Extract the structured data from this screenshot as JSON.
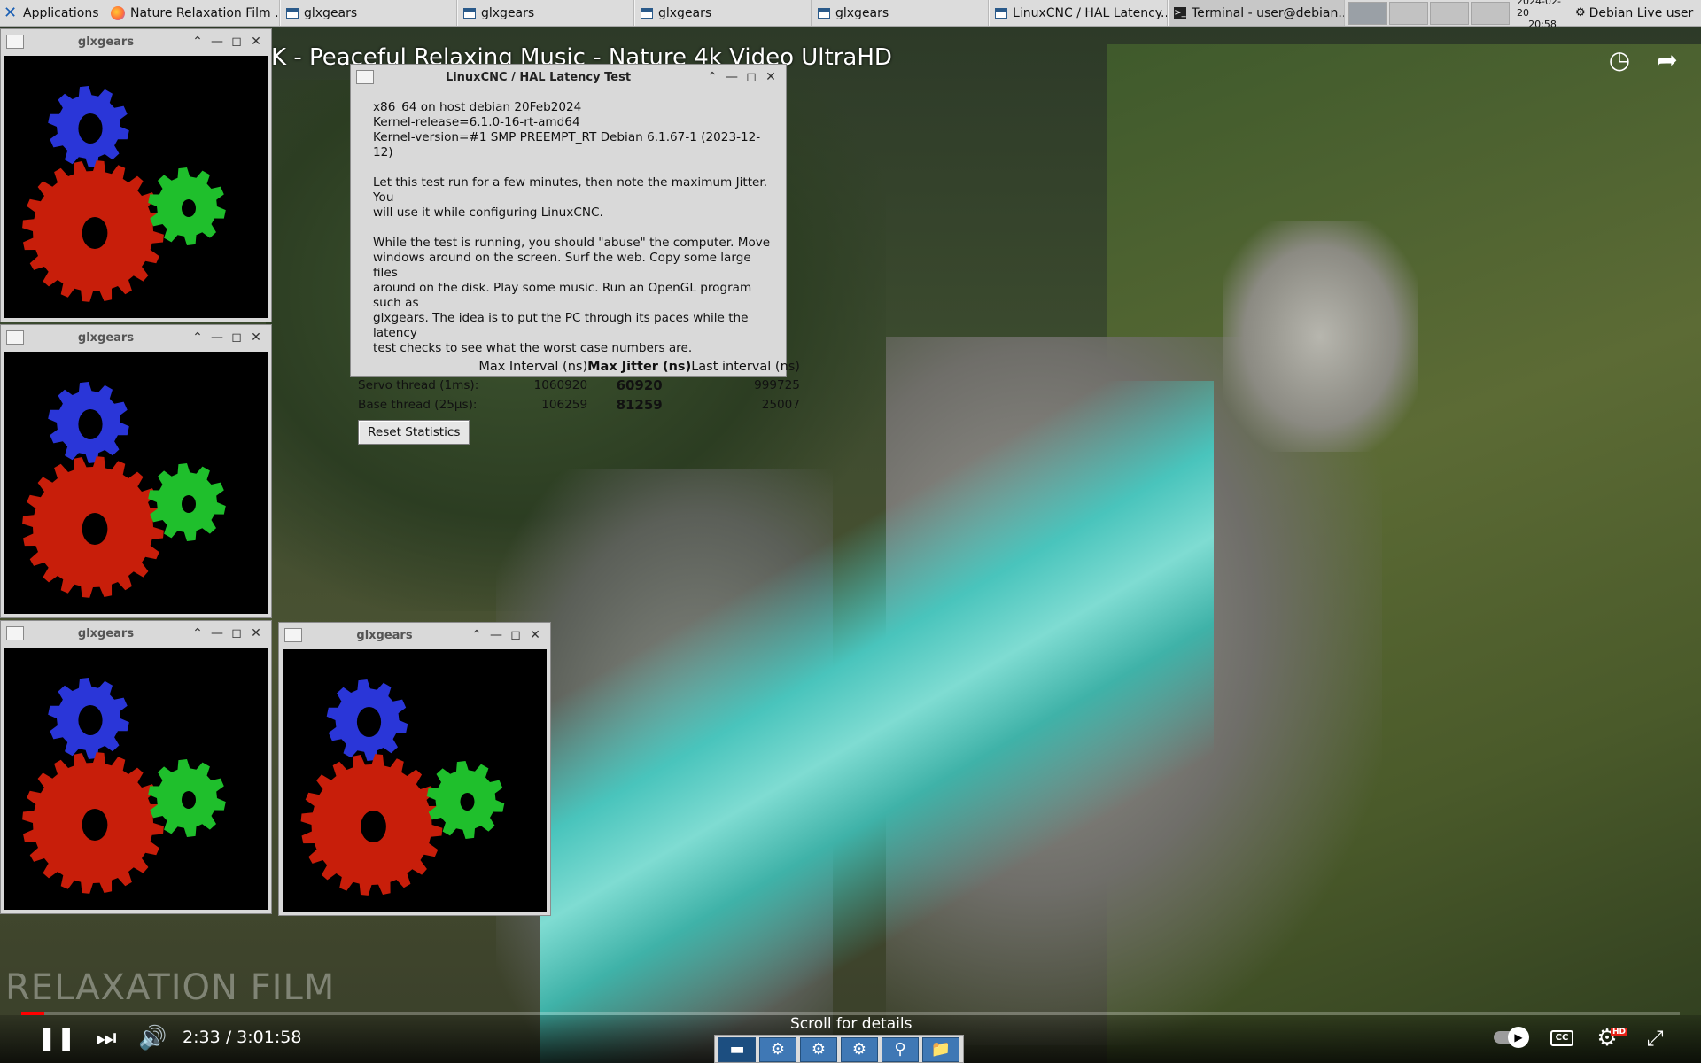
{
  "taskbar": {
    "applications_label": "Applications",
    "tasks": [
      {
        "label": "Nature Relaxation Film ...",
        "icon": "firefox-icon"
      },
      {
        "label": "glxgears",
        "icon": "window-icon"
      },
      {
        "label": "glxgears",
        "icon": "window-icon"
      },
      {
        "label": "glxgears",
        "icon": "window-icon"
      },
      {
        "label": "glxgears",
        "icon": "window-icon"
      },
      {
        "label": "LinuxCNC / HAL Latency...",
        "icon": "window-icon"
      },
      {
        "label": "Terminal - user@debian...",
        "icon": "terminal-icon"
      }
    ],
    "clock_date": "2024-02-20",
    "clock_time": "20:58",
    "user": "Debian Live user"
  },
  "video": {
    "title": "K - Peaceful Relaxing Music - Nature 4k Video UltraHD",
    "watermark": "RELAXATION FILM",
    "time_current": "2:33",
    "time_total": "3:01:58",
    "time_separator": " / ",
    "progress_fraction": 0.014,
    "scroll_hint": "Scroll for details",
    "hd_label": "HD",
    "cc_label": "CC"
  },
  "glxgears_windows": [
    {
      "title": "glxgears"
    },
    {
      "title": "glxgears"
    },
    {
      "title": "glxgears"
    },
    {
      "title": "glxgears"
    }
  ],
  "latency": {
    "title": "LinuxCNC / HAL Latency Test",
    "info": "x86_64 on host debian 20Feb2024\nKernel-release=6.1.0-16-rt-amd64\nKernel-version=#1 SMP PREEMPT_RT Debian 6.1.67-1 (2023-12-12)",
    "instructions": "Let this test run for a few minutes, then note the maximum Jitter. You\nwill use it while configuring LinuxCNC.",
    "abuse": "While the test is running, you should \"abuse\" the computer. Move\nwindows around on the screen. Surf the web. Copy some large files\naround on the disk. Play some music. Run an OpenGL program such as\nglxgears. The idea is to put the PC through its paces while the latency\ntest checks to see what the worst case numbers are.",
    "headers": [
      "Max Interval (ns)",
      "Max Jitter (ns)",
      "Last interval (ns)"
    ],
    "rows": [
      {
        "label": "Servo thread (1ms):",
        "max_interval": "1060920",
        "max_jitter": "60920",
        "last_interval": "999725"
      },
      {
        "label": "Base thread (25µs):",
        "max_interval": "106259",
        "max_jitter": "81259",
        "last_interval": "25007"
      }
    ],
    "reset_label": "Reset Statistics"
  },
  "colors": {
    "gear_red": "#c81e0a",
    "gear_green": "#1fbf2c",
    "gear_blue": "#2a36d8",
    "progress_red": "#ff0000"
  }
}
